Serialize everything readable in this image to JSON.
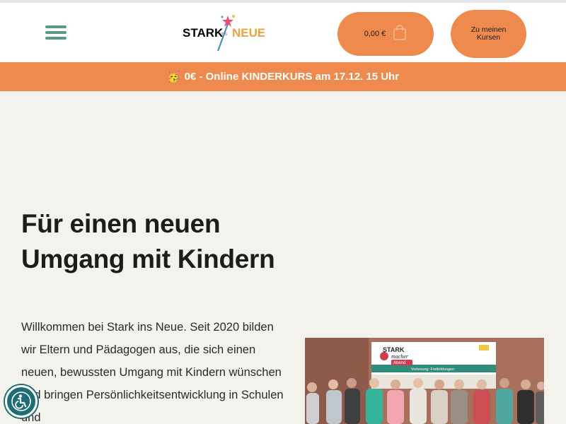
{
  "header": {
    "menu_icon": "hamburger-menu-icon",
    "logo": {
      "word1": "STARK",
      "word2": "ins",
      "word3": "NEUE"
    },
    "cart": {
      "amount": "0,00 €",
      "icon": "shopping-bag-icon"
    },
    "courses_button": "Zu meinen Kursen"
  },
  "banner": {
    "emoji": "🥳",
    "text": "0€ - Online KINDERKURS am 17.12. 15 Uhr"
  },
  "hero": {
    "title": "Für einen neuen Umgang mit Kindern",
    "text": "Willkommen bei Stark ins Neue. Seit 2020 bilden wir Eltern und Pädagogen aus, die sich einen neuen, bewussten Umgang mit Kindern wünschen und bringen Persönlichkeitsentwicklung in Schulen und"
  },
  "photo": {
    "sign_line1": "STARK",
    "sign_line2": "macher",
    "sign_line3": "Abend",
    "sign_subtitle": "Vorlesung: Fortbildungen",
    "alt_icon": "event-photo"
  },
  "accessibility": {
    "icon": "accessibility-icon"
  },
  "colors": {
    "accent": "#ef8a4f",
    "menu": "#5b9b86",
    "a11y": "#1f6d74",
    "background": "#f4f2ec"
  }
}
